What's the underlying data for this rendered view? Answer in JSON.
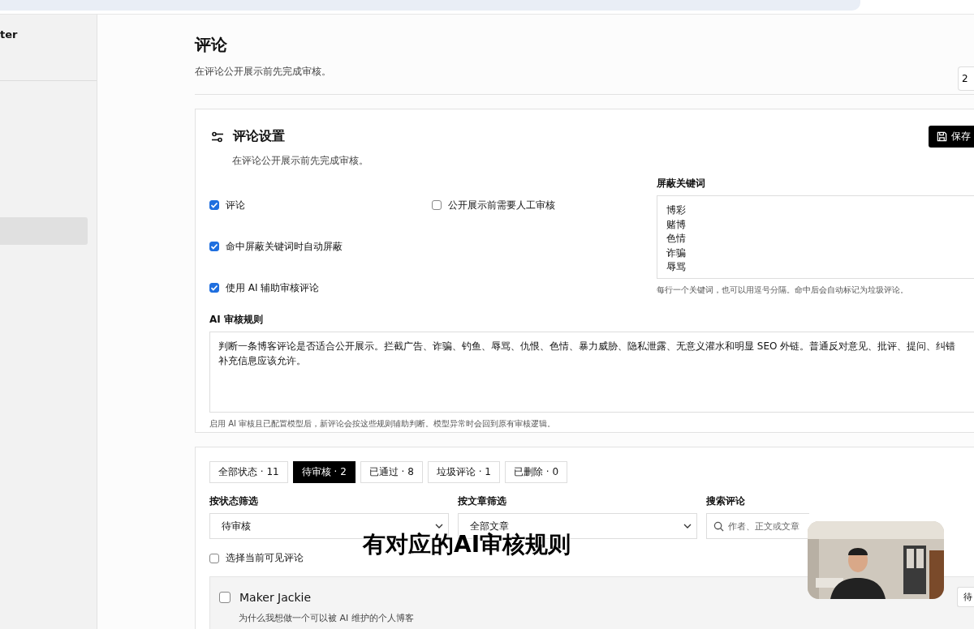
{
  "sidebar": {
    "brand": "ter",
    "items": [
      {
        "selected": true
      }
    ]
  },
  "header": {
    "title": "评论",
    "subtitle": "在评论公开展示前先完成审核。",
    "corner_button": "2"
  },
  "settings": {
    "title": "评论设置",
    "subtitle": "在评论公开展示前先完成审核。",
    "save_button": "保存",
    "option_columns": [
      [
        {
          "label": "评论",
          "checked": true
        },
        {
          "label": "命中屏蔽关键词时自动屏蔽",
          "checked": true
        },
        {
          "label": "使用 AI 辅助审核评论",
          "checked": true
        }
      ],
      [
        {
          "label": "公开展示前需要人工审核",
          "checked": false
        }
      ]
    ],
    "keywords": {
      "label": "屏蔽关键词",
      "lines": [
        "博彩",
        "赌博",
        "色情",
        "诈骗",
        "辱骂"
      ],
      "hint": "每行一个关键词，也可以用逗号分隔。命中后会自动标记为垃圾评论。"
    },
    "ai_rules": {
      "label": "AI 审核规则",
      "lines": [
        "判断一条博客评论是否适合公开展示。拦截广告、诈骗、钓鱼、辱骂、仇恨、色情、暴力威胁、隐私泄露、无意义灌水和明显 SEO 外链。普通反对意见、批评、提问、纠错",
        "补充信息应该允许。"
      ],
      "hint": "启用 AI 审核且已配置模型后，新评论会按这些规则辅助判断。模型异常时会回到原有审核逻辑。"
    }
  },
  "comments": {
    "tabs": [
      {
        "label": "全部状态 · 11",
        "selected": false
      },
      {
        "label": "待审核 · 2",
        "selected": true
      },
      {
        "label": "已通过 · 8",
        "selected": false
      },
      {
        "label": "垃圾评论 · 1",
        "selected": false
      },
      {
        "label": "已删除 · 0",
        "selected": false
      }
    ],
    "filters": [
      {
        "kind": "select",
        "label": "按状态筛选",
        "value": "待审核"
      },
      {
        "kind": "select",
        "label": "按文章筛选",
        "value": "全部文章"
      },
      {
        "kind": "search",
        "label": "搜索评论",
        "placeholder": "作者、正文或文章"
      }
    ],
    "select_visible": {
      "label": "选择当前可见评论",
      "checked": false
    },
    "items": [
      {
        "author": "Maker Jackie",
        "post": "为什么我想做一个可以被 AI 维护的个人博客",
        "status": "待",
        "checked": false
      }
    ]
  },
  "caption": "有对应的AI审核规则"
}
